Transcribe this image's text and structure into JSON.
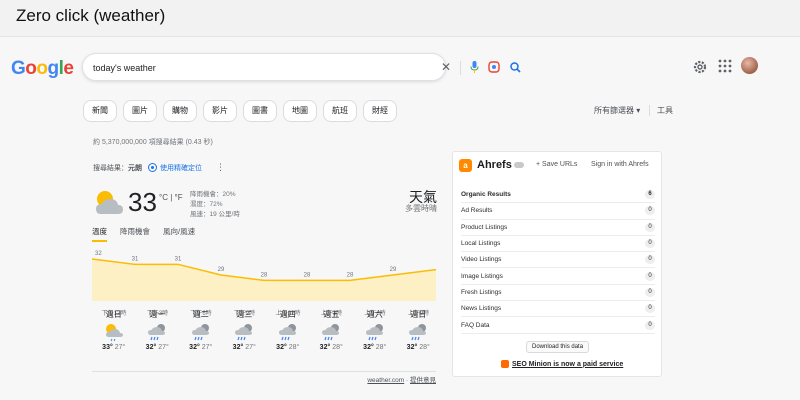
{
  "slide": {
    "title": "Zero click (weather)"
  },
  "google": {
    "logo_letters": [
      {
        "char": "G",
        "color": "#4285f4"
      },
      {
        "char": "o",
        "color": "#ea4335"
      },
      {
        "char": "o",
        "color": "#fbbc05"
      },
      {
        "char": "g",
        "color": "#4285f4"
      },
      {
        "char": "l",
        "color": "#34a853"
      },
      {
        "char": "e",
        "color": "#ea4335"
      }
    ]
  },
  "search": {
    "query": "today's weather"
  },
  "chips": [
    "新聞",
    "圖片",
    "購物",
    "影片",
    "圖書",
    "地圖",
    "航班",
    "財經"
  ],
  "toolbar": {
    "filters": "所有篩選器 ▾",
    "tools": "工具"
  },
  "results": {
    "stats": "約 5,370,000,000 項搜尋結果 (0.43 秒)"
  },
  "weather": {
    "location_prefix": "搜尋結果：",
    "location": "元朗",
    "precise_location": "使用精確定位",
    "temperature": "33",
    "units": "°C | °F",
    "precipitation": "降雨機會：20%",
    "humidity": "濕度：72%",
    "wind": "風速：19 公里/時",
    "title": "天氣",
    "condition": "多雲時晴",
    "tabs": [
      "溫度",
      "降雨機會",
      "風向/風速"
    ],
    "active_tab": 0,
    "source": "weather.com",
    "feedback": "提供意見",
    "days": [
      {
        "name": "週日",
        "high": "33°",
        "low": "27°",
        "icon": "partly-sunny-rain-icon"
      },
      {
        "name": "週一",
        "high": "32°",
        "low": "27°",
        "icon": "rain-cloud-icon"
      },
      {
        "name": "週二",
        "high": "32°",
        "low": "27°",
        "icon": "rain-cloud-icon"
      },
      {
        "name": "週三",
        "high": "32°",
        "low": "27°",
        "icon": "rain-cloud-icon"
      },
      {
        "name": "週四",
        "high": "32°",
        "low": "28°",
        "icon": "rain-cloud-icon"
      },
      {
        "name": "週五",
        "high": "32°",
        "low": "28°",
        "icon": "rain-cloud-icon"
      },
      {
        "name": "週六",
        "high": "32°",
        "low": "28°",
        "icon": "rain-cloud-icon"
      },
      {
        "name": "週日",
        "high": "32°",
        "low": "28°",
        "icon": "rain-cloud-icon"
      }
    ]
  },
  "chart_data": {
    "type": "area",
    "x": [
      "下午12時",
      "下午3時",
      "下午6時",
      "下午9時",
      "上午12時",
      "上午3時",
      "上午6時",
      "上午9時"
    ],
    "values": [
      32,
      31,
      31,
      29,
      28,
      28,
      28,
      29,
      30
    ],
    "ylim": [
      20,
      35
    ],
    "grid": false,
    "color": "#fbbc04",
    "fill": "#fdf0c4"
  },
  "ahrefs": {
    "name": "Ahrefs",
    "save_urls": "+ Save URLs",
    "sign_in": "Sign in with Ahrefs",
    "rows": [
      {
        "label": "Organic Results",
        "count": "6"
      },
      {
        "label": "Ad Results",
        "count": "0"
      },
      {
        "label": "Product Listings",
        "count": "0"
      },
      {
        "label": "Local Listings",
        "count": "0"
      },
      {
        "label": "Video Listings",
        "count": "0"
      },
      {
        "label": "Image Listings",
        "count": "0"
      },
      {
        "label": "Fresh Listings",
        "count": "0"
      },
      {
        "label": "News Listings",
        "count": "0"
      },
      {
        "label": "FAQ Data",
        "count": "0"
      }
    ],
    "download": "Download this data",
    "promo": "SEO Minion is now a paid service"
  }
}
